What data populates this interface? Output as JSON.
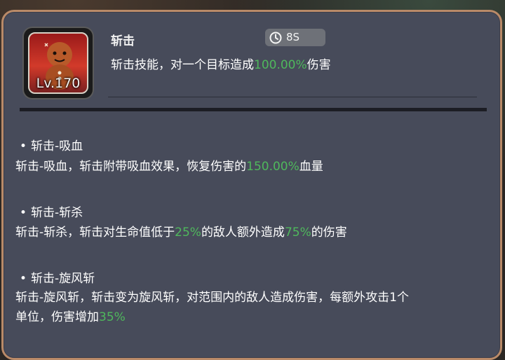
{
  "skill": {
    "name": "斩击",
    "cooldown": "8S",
    "level": "Lv.170",
    "desc_prefix": "斩击技能，对一个目标造成",
    "desc_value": "100.00%",
    "desc_suffix": "伤害"
  },
  "upgrades": [
    {
      "title": "斩击-吸血",
      "desc": [
        "斩击-吸血，斩击附带吸血效果，恢复伤害的",
        "150.00%",
        "血量"
      ]
    },
    {
      "title": "斩击-斩杀",
      "desc": [
        "斩击-斩杀，斩击对生命值低于",
        "25%",
        "的敌人额外造成",
        "75%",
        "的伤害"
      ]
    },
    {
      "title": "斩击-旋风斩",
      "desc_line1": "斩击-旋风斩，斩击变为旋风斩，对范围内的敌人造成伤害，每额外攻击1个",
      "desc_line2": "单位，伤害增加",
      "desc_value": "35%"
    }
  ],
  "icons": {
    "cooldown": "clock-icon",
    "bullet": "bullet-dot",
    "portrait": "gingerbread-character-icon"
  },
  "colors": {
    "panel": "#474b5a",
    "border": "#b98a68",
    "highlight": "#4fb85c"
  }
}
